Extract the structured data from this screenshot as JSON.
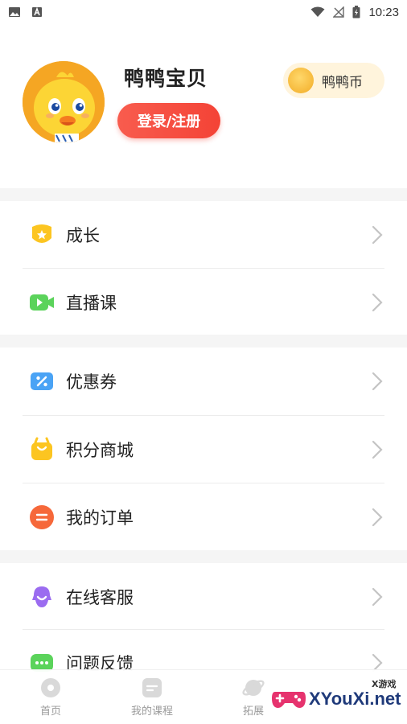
{
  "status_bar": {
    "time": "10:23",
    "icons": [
      "image-icon",
      "text-a-icon",
      "wifi-icon",
      "signal-icon",
      "battery-icon"
    ]
  },
  "profile": {
    "username": "鸭鸭宝贝",
    "login_button": "登录/注册",
    "coin_label": "鸭鸭币"
  },
  "menu": {
    "groups": [
      [
        {
          "label": "成长",
          "icon": "badge-icon",
          "color": "#fcc521"
        },
        {
          "label": "直播课",
          "icon": "video-icon",
          "color": "#5bd35b"
        }
      ],
      [
        {
          "label": "优惠券",
          "icon": "coupon-icon",
          "color": "#4aa3f5"
        },
        {
          "label": "积分商城",
          "icon": "shopping-bag-icon",
          "color": "#fcc521"
        },
        {
          "label": "我的订单",
          "icon": "order-icon",
          "color": "#f6683a"
        }
      ],
      [
        {
          "label": "在线客服",
          "icon": "customer-service-icon",
          "color": "#9b6cf0"
        },
        {
          "label": "问题反馈",
          "icon": "feedback-icon",
          "color": "#5bd35b"
        }
      ]
    ]
  },
  "tabbar": {
    "tabs": [
      {
        "label": "首页",
        "icon": "home-icon"
      },
      {
        "label": "我的课程",
        "icon": "course-icon"
      },
      {
        "label": "拓展",
        "icon": "explore-icon"
      }
    ]
  },
  "watermark": {
    "text": "XYouXi.net",
    "small": "X游戏"
  }
}
